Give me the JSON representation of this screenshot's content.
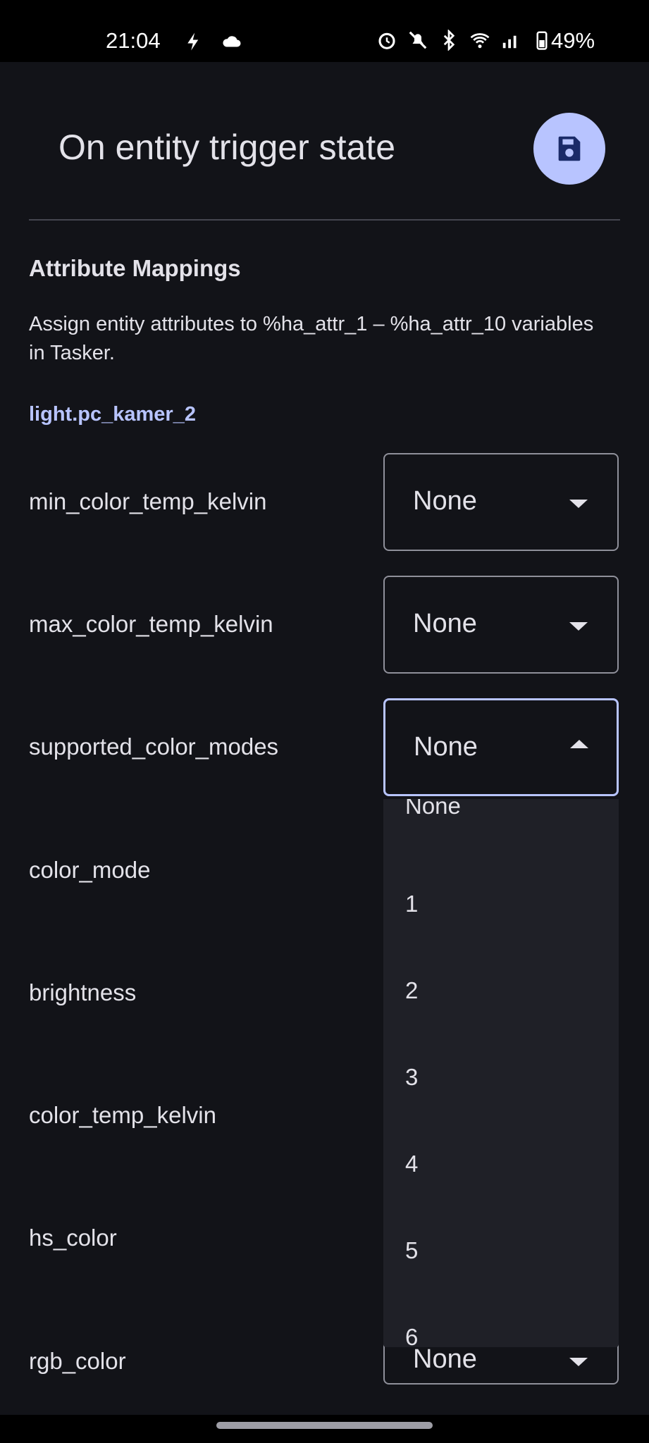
{
  "status_bar": {
    "time": "21:04",
    "battery": "49%",
    "icons": [
      "lightning-icon",
      "cloud-icon",
      "alarm-icon",
      "mute-icon",
      "bluetooth-icon",
      "wifi-icon",
      "signal-icon",
      "battery-icon"
    ]
  },
  "header": {
    "title": "On entity trigger state",
    "save_icon": "save-icon"
  },
  "section": {
    "title": "Attribute Mappings",
    "description": "Assign entity attributes to %ha_attr_1 – %ha_attr_10 variables in Tasker.",
    "entity": "light.pc_kamer_2"
  },
  "rows": [
    {
      "label": "min_color_temp_kelvin",
      "value": "None"
    },
    {
      "label": "max_color_temp_kelvin",
      "value": "None"
    },
    {
      "label": "supported_color_modes",
      "value": "None"
    },
    {
      "label": "color_mode"
    },
    {
      "label": "brightness"
    },
    {
      "label": "color_temp_kelvin"
    },
    {
      "label": "hs_color"
    },
    {
      "label": "rgb_color",
      "value": "None"
    }
  ],
  "menu": {
    "items": [
      "None",
      "1",
      "2",
      "3",
      "4",
      "5",
      "6"
    ]
  },
  "colors": {
    "background": "#121318",
    "accent": "#b8c4ff",
    "menu_background": "#1f2027"
  }
}
